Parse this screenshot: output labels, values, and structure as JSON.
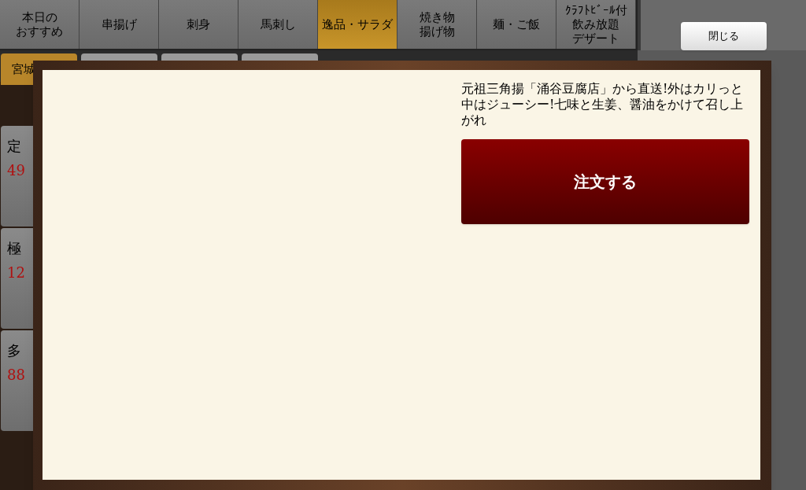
{
  "category_tabs": [
    {
      "lines": [
        "本日の",
        "おすすめ"
      ],
      "selected": false
    },
    {
      "lines": [
        "串揚げ"
      ],
      "selected": false
    },
    {
      "lines": [
        "刺身"
      ],
      "selected": false
    },
    {
      "lines": [
        "馬刺し"
      ],
      "selected": false
    },
    {
      "lines": [
        "逸品・サラダ"
      ],
      "selected": true
    },
    {
      "lines": [
        "焼き物",
        "揚げ物"
      ],
      "selected": false
    },
    {
      "lines": [
        "麺・ご飯"
      ],
      "selected": false
    },
    {
      "lines": [
        "ｸﾗﾌﾄﾋﾞｰﾙ付",
        "飲み放題",
        "デザート"
      ],
      "selected": false
    }
  ],
  "close_button": "閉じる",
  "sub_tabs": [
    {
      "label": "宮城",
      "selected": true
    },
    {
      "selected": false
    },
    {
      "selected": false
    },
    {
      "selected": false
    }
  ],
  "menu_items": [
    {
      "name": "定",
      "price": "49"
    },
    {
      "name": "極",
      "price": "12"
    },
    {
      "name": "多",
      "price": "88"
    }
  ],
  "dialog": {
    "description": "元祖三角揚「涌谷豆腐店」から直送!外はカリっと中はジューシー!七味と生姜、醤油をかけて召し上がれ",
    "order_button": "注文する"
  }
}
